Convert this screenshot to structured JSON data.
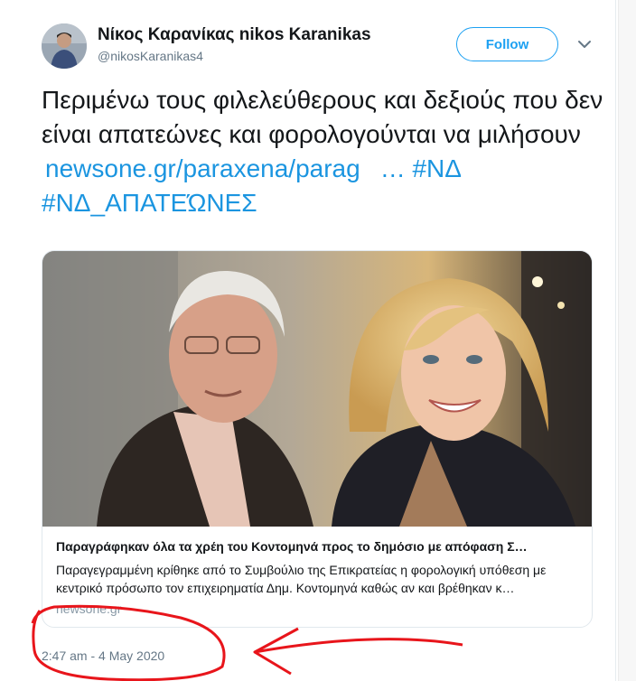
{
  "tweet": {
    "author_name": "Νίκος Καρανίκας nikos Karanikas",
    "author_handle": "@nikosKaranikas4",
    "follow_label": "Follow",
    "text_main": "Περιμένω τους φιλελεύθερους και δεξιούς που δεν είναι απατεώνες και φορολογούνται να μιλήσουν",
    "link": "newsone.gr/paraxena/parag",
    "ellipsis": "…",
    "hashtag1": "#ΝΔ",
    "hashtag2": "#ΝΔ_ΑΠΑΤΕΏΝΕΣ",
    "timestamp": "2:47 am - 4 May 2020"
  },
  "card": {
    "title": "Παραγράφηκαν όλα τα χρέη του Κοντομηνά προς το δημόσιο με απόφαση Σ…",
    "description": "Παραγεγραμμένη κρίθηκε από το Συμβούλιο της Επικρατείας η φορολογική υπόθεση με κεντρικό πρόσωπο τον επιχειρηματία Δημ. Κοντομηνά καθώς αν και βρέθηκαν κ…",
    "domain": "newsone.gr"
  },
  "colors": {
    "accent": "#1da1f2",
    "link": "#1b95e0",
    "annotation": "#e8151b"
  },
  "icons": {
    "caret": "chevron-down-icon"
  }
}
